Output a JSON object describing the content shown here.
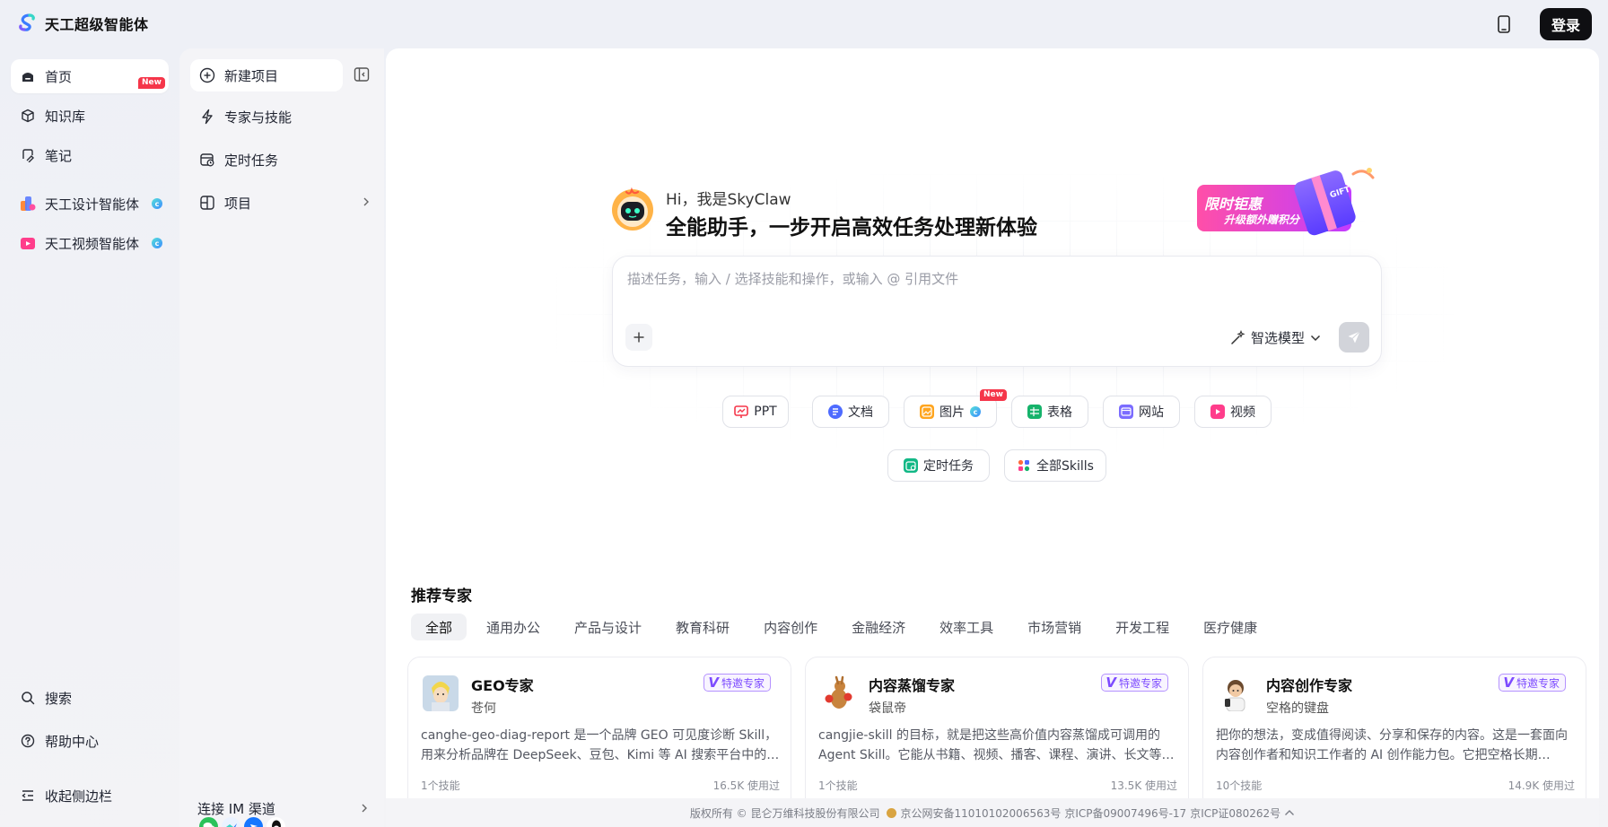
{
  "app": {
    "title": "天工超级智能体",
    "login_label": "登录"
  },
  "nav": {
    "items": [
      {
        "label": "首页"
      },
      {
        "label": "知识库"
      },
      {
        "label": "笔记",
        "badge": "New"
      },
      {
        "label": "天工设计智能体"
      },
      {
        "label": "天工视频智能体"
      }
    ],
    "bottom": [
      {
        "label": "搜索"
      },
      {
        "label": "帮助中心"
      },
      {
        "label": "收起侧边栏"
      }
    ]
  },
  "panel": {
    "items": [
      {
        "label": "新建项目"
      },
      {
        "label": "专家与技能"
      },
      {
        "label": "定时任务"
      },
      {
        "label": "项目"
      }
    ],
    "im_label": "连接 IM 渠道"
  },
  "hero": {
    "greeting": "Hi，我是SkyClaw",
    "tagline": "全能助手，一步开启高效任务处理新体验",
    "promo_line1": "限时钜惠",
    "promo_line2": "升级额外赠积分",
    "promo_gift": "GIFT"
  },
  "composer": {
    "placeholder": "描述任务，输入 / 选择技能和操作，或输入 @ 引用文件",
    "model_label": "智选模型"
  },
  "chips": [
    {
      "label": "PPT",
      "color": "#f5364a"
    },
    {
      "label": "文档",
      "color": "#4e6bff"
    },
    {
      "label": "图片",
      "color": "#ffa51f",
      "badge": "New"
    },
    {
      "label": "表格",
      "color": "#16b36b"
    },
    {
      "label": "网站",
      "color": "#7b6cff"
    },
    {
      "label": "视频",
      "color": "#ff3d8b"
    },
    {
      "label": "定时任务",
      "color": "#12b886"
    },
    {
      "label": "全部Skills",
      "color": "#ff6b3d"
    }
  ],
  "experts": {
    "title": "推荐专家",
    "tabs": [
      "全部",
      "通用办公",
      "产品与设计",
      "教育科研",
      "内容创作",
      "金融经济",
      "效率工具",
      "市场营销",
      "开发工程",
      "医疗健康"
    ],
    "tag_label": "特邀专家",
    "cards": [
      {
        "name": "GEO专家",
        "author": "苍何",
        "desc": "canghe-geo-diag-report 是一个品牌 GEO 可见度诊断 Skill，用来分析品牌在 DeepSeek、豆包、Kimi 等 AI 搜索平台中的提及…",
        "skills": "1个技能",
        "uses": "16.5K 使用过"
      },
      {
        "name": "内容蒸馏专家",
        "author": "袋鼠帝",
        "desc": "cangjie-skill 的目标，就是把这些高价值内容蒸馏成可调用的 Agent Skill。它能从书籍、视频、播客、课程、演讲、长文等…",
        "skills": "1个技能",
        "uses": "13.5K 使用过"
      },
      {
        "name": "内容创作专家",
        "author": "空格的键盘",
        "desc": "把你的想法，变成值得阅读、分享和保存的内容。这是一套面向内容创作者和知识工作者的 AI 创作能力包。它把空格长期…",
        "skills": "10个技能",
        "uses": "14.9K 使用过"
      }
    ]
  },
  "footer": {
    "text": "版权所有 © 昆仑万维科技股份有限公司",
    "icp1": "京公网安备11010102006563号",
    "icp2": "京ICP备09007496号-17",
    "icp3": "京ICP证080262号"
  }
}
